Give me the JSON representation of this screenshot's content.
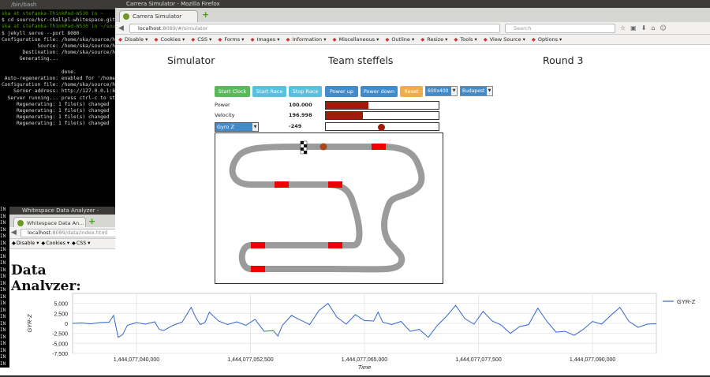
{
  "terminal": {
    "title": "/bin/bash",
    "lines": [
      {
        "t": "ska at stefanka-ThinkPad-W530 in ~",
        "c": "g"
      },
      {
        "t": "$ cd source/hsr-challpl-whitespace.git",
        "c": ""
      },
      {
        "t": "ska at stefanka-ThinkPad-W530 in ~/sou",
        "c": "g"
      },
      {
        "t": "$ jekyll serve --port 8080",
        "c": ""
      },
      {
        "t": "Configuration file: /home/ska/source/h",
        "c": ""
      },
      {
        "t": "            Source: /home/ska/source/h",
        "c": ""
      },
      {
        "t": "       Destination: /home/ska/source/h",
        "c": ""
      },
      {
        "t": "      Generating...",
        "c": ""
      },
      {
        "t": "",
        "c": ""
      },
      {
        "t": "                    done.",
        "c": ""
      },
      {
        "t": " Auto-regeneration: enabled for '/home",
        "c": ""
      },
      {
        "t": "Configuration file: /home/ska/source/h",
        "c": ""
      },
      {
        "t": "    Server address: http://127.0.0.1:8",
        "c": ""
      },
      {
        "t": "  Server running... press ctrl-c to st",
        "c": ""
      },
      {
        "t": "     Regenerating: 1 file(s) changed",
        "c": ""
      },
      {
        "t": "     Regenerating: 1 file(s) changed",
        "c": ""
      },
      {
        "t": "     Regenerating: 1 file(s) changed",
        "c": ""
      },
      {
        "t": "     Regenerating: 1 file(s) changed",
        "c": ""
      }
    ]
  },
  "main_window": {
    "title": "Carrera Simulator - Mozilla Firefox",
    "tab_label": "Carrera Simulator",
    "url_host": "localhost",
    "url_path": ":8089/#/simulator",
    "search_placeholder": "Search",
    "devbar": [
      "Disable",
      "Cookies",
      "CSS",
      "Forms",
      "Images",
      "Information",
      "Miscellaneous",
      "Outline",
      "Resize",
      "Tools",
      "View Source",
      "Options"
    ]
  },
  "simulator": {
    "header_left": "Simulator",
    "header_center": "Team steffels",
    "header_right": "Round 3",
    "buttons": {
      "start_clock": "Start Clock",
      "start_race": "Start Race",
      "stop_race": "Stop Race",
      "power_up": "Power up",
      "power_down": "Power down",
      "reset": "Reset"
    },
    "size_select": "600x400",
    "track_select": "Budapest",
    "power_label": "Power",
    "power_value": "100.000",
    "power_fill": 0.38,
    "velocity_label": "Velocity",
    "velocity_value": "196.998",
    "velocity_fill": 0.33,
    "gyro_select": "Gyro Z",
    "gyro_value": "-249",
    "gyro_position": 0.49
  },
  "analyzer_window": {
    "title": "Whitespace Data Analyzer - Mozilla Firefox",
    "tab_label": "Whitespace Data An...",
    "url_host": "localhost",
    "url_path": ":8089/data/index.html",
    "devbar": [
      "Disable",
      "Cookies",
      "CSS"
    ],
    "heading": "Data Analyzer:",
    "info_lines": [
      "IN",
      "IN",
      "IN",
      "IN",
      "IN",
      "IN",
      "IN",
      "IN",
      "IN",
      "IN",
      "IN",
      "IN",
      "IN",
      "IN",
      "IN",
      "IN",
      "IN",
      "IN",
      "IN",
      "IN",
      "IN",
      "IN",
      "IN",
      "IN"
    ]
  },
  "colors": {
    "accent_green": "#5cb85c",
    "accent_teal": "#5bc0de",
    "accent_blue": "#428bca",
    "accent_orange": "#f0ad4e",
    "bar_fill": "#a11a0a",
    "series": "#3366cc"
  },
  "chart_data": {
    "type": "line",
    "xlabel": "Time",
    "ylabel": "GYR-Z",
    "ylim": [
      -7500,
      7500
    ],
    "yticks": [
      "5,000",
      "2,500",
      "0",
      "-2,500",
      "-5,000",
      "-7,500"
    ],
    "xticks": [
      "1,444,077,040,000",
      "1,444,077,052,500",
      "1,444,077,065,000",
      "1,444,077,077,500",
      "1,444,077,090,000"
    ],
    "xlim": [
      1444077033000,
      1444077097000
    ],
    "legend": "top-right",
    "series": [
      {
        "name": "GYR-Z",
        "x": [
          1444077033000,
          1444077034000,
          1444077035000,
          1444077036000,
          1444077037000,
          1444077037500,
          1444077038000,
          1444077038500,
          1444077039000,
          1444077040000,
          1444077041000,
          1444077042000,
          1444077042500,
          1444077043000,
          1444077044000,
          1444077045000,
          1444077046000,
          1444077046500,
          1444077047000,
          1444077047500,
          1444077048000,
          1444077049000,
          1444077050000,
          1444077051000,
          1444077052000,
          1444077053000,
          1444077054000,
          1444077055000,
          1444077055500,
          1444077056000,
          1444077057000,
          1444077058000,
          1444077059000,
          1444077060000,
          1444077061000,
          1444077062000,
          1444077063000,
          1444077064000,
          1444077065000,
          1444077066000,
          1444077066500,
          1444077067000,
          1444077068000,
          1444077069000,
          1444077070000,
          1444077071000,
          1444077072000,
          1444077073000,
          1444077074000,
          1444077075000,
          1444077076000,
          1444077077000,
          1444077078000,
          1444077079000,
          1444077080000,
          1444077080500,
          1444077081000,
          1444077082000,
          1444077083000,
          1444077084000,
          1444077085000,
          1444077086000,
          1444077087000,
          1444077088000,
          1444077089000,
          1444077090000,
          1444077091000,
          1444077092000,
          1444077093000,
          1444077094000,
          1444077095000,
          1444077096000,
          1444077097000
        ],
        "values": [
          0,
          100,
          -100,
          200,
          300,
          2000,
          -3500,
          -2800,
          -500,
          200,
          -200,
          400,
          -1500,
          -1800,
          -500,
          300,
          4000,
          1500,
          -300,
          200,
          2800,
          600,
          -300,
          400,
          -500,
          1000,
          -2000,
          -1800,
          -3200,
          -500,
          2000,
          800,
          -300,
          3200,
          5000,
          1500,
          -200,
          2200,
          700,
          600,
          2800,
          300,
          -300,
          500,
          -2000,
          -1500,
          -3500,
          -500,
          1800,
          4500,
          1200,
          -200,
          3000,
          600,
          -400,
          -1500,
          -2500,
          -800,
          -300,
          3800,
          500,
          -2200,
          -2000,
          -3000,
          -1500,
          500,
          -200,
          2000,
          4000,
          500,
          -1000,
          -200,
          -100
        ]
      }
    ]
  }
}
